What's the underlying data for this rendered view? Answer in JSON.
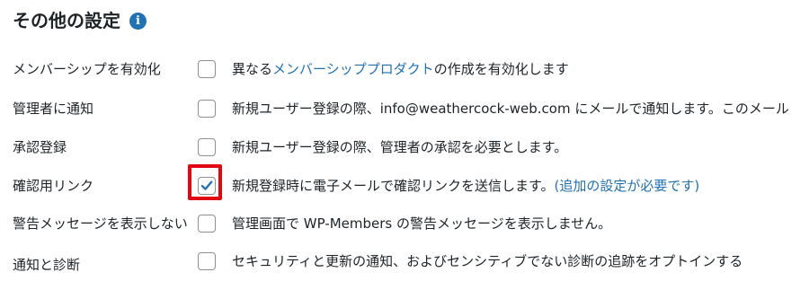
{
  "section": {
    "title": "その他の設定",
    "info_icon": "info-icon"
  },
  "rows": [
    {
      "label": "メンバーシップを有効化",
      "checked": false,
      "desc_before": "異なる",
      "desc_link": "メンバーシッププロダクト",
      "desc_after": "の作成を有効化します"
    },
    {
      "label": "管理者に通知",
      "checked": false,
      "desc": "新規ユーザー登録の際、info@weathercock-web.com にメールで通知します。このメール"
    },
    {
      "label": "承認登録",
      "checked": false,
      "desc": "新規ユーザー登録の際、管理者の承認を必要とします。"
    },
    {
      "label": "確認用リンク",
      "checked": true,
      "desc": "新規登録時に電子メールで確認リンクを送信します。",
      "desc_link": "(追加の設定が必要です)"
    },
    {
      "label": "警告メッセージを表示しない",
      "checked": false,
      "desc": "管理画面で WP-Members の警告メッセージを表示しません。"
    },
    {
      "label": "通知と診断",
      "checked": false,
      "desc": "セキュリティと更新の通知、およびセンシティブでない診断の追跡をオプトインする"
    }
  ],
  "colors": {
    "link": "#2271b1",
    "highlight": "#e1060f",
    "checkbox_border": "#8c8f94",
    "checkmark": "#2271b1"
  }
}
